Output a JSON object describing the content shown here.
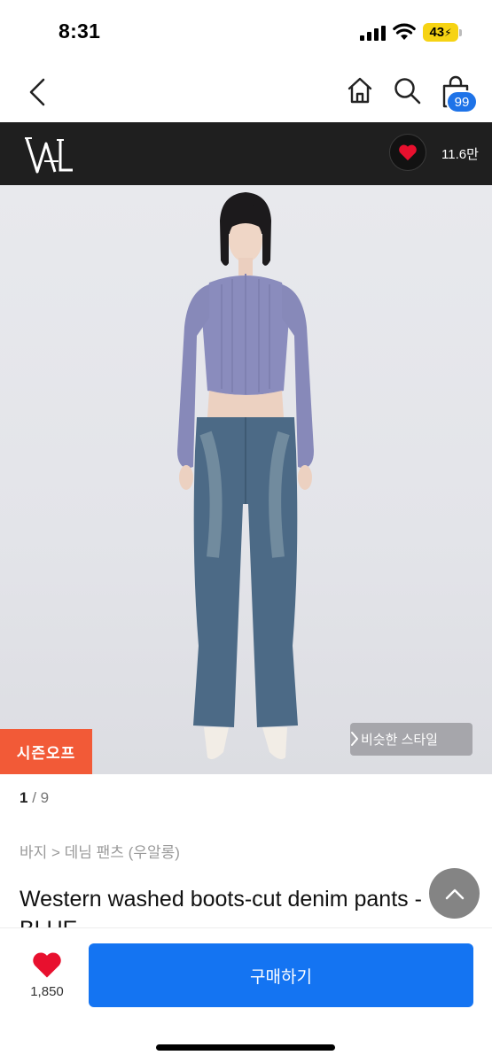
{
  "status": {
    "time": "8:31",
    "battery": "43"
  },
  "nav": {
    "cart_count": "99"
  },
  "brand": {
    "like_count": "11.6만"
  },
  "image": {
    "badge": "시즌오프",
    "similar_label": "비슷한 스타일",
    "page_current": "1",
    "page_separator": "/",
    "page_total": "9"
  },
  "product": {
    "breadcrumb": "바지 > 데님 팬츠 (우알롱)",
    "title": "Western washed boots-cut denim pants - BLUE"
  },
  "bottom": {
    "wish_count": "1,850",
    "buy_label": "구매하기"
  },
  "colors": {
    "accent": "#1474f2",
    "badge": "#f25a37",
    "heart": "#e8102e",
    "brand_bar": "#1f1f1f"
  }
}
